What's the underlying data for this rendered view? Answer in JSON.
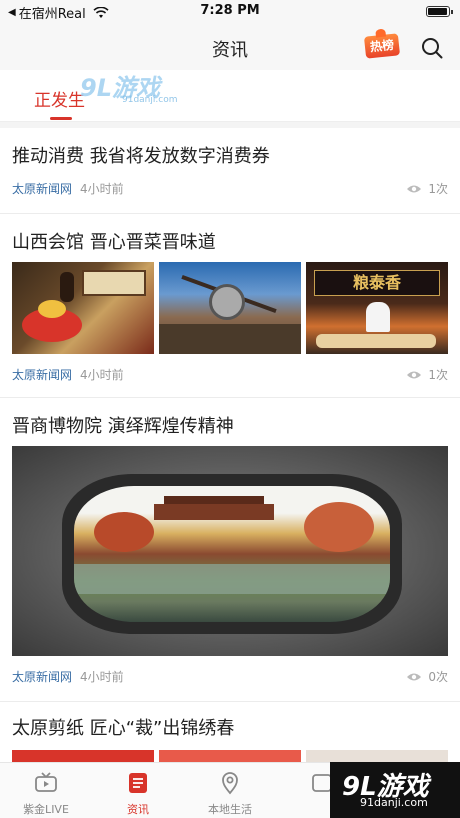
{
  "status_bar": {
    "back_app": "在宿州Real",
    "time": "7:28 PM"
  },
  "nav": {
    "title": "资讯",
    "hot_badge": "热榜"
  },
  "channel": {
    "active_tab": "正发生"
  },
  "articles": [
    {
      "title": "推动消费 我省将发放数字消费券",
      "source": "太原新闻网",
      "time": "4小时前",
      "views": "1次"
    },
    {
      "title": "山西会馆 晋心晋菜晋味道",
      "source": "太原新闻网",
      "time": "4小时前",
      "views": "1次",
      "image_sign_text": "粮泰香"
    },
    {
      "title": "晋商博物院 演绎辉煌传精神",
      "source": "太原新闻网",
      "time": "4小时前",
      "views": "0次"
    },
    {
      "title": "太原剪纸 匠心“裁”出锦绣春"
    }
  ],
  "tab_bar": {
    "tabs": [
      {
        "label": "紫金LIVE"
      },
      {
        "label": "资讯"
      },
      {
        "label": "本地生活"
      }
    ]
  },
  "watermark": {
    "logo": "9L游戏",
    "url": "91danji.com"
  },
  "colors": {
    "accent": "#d8342a",
    "source_link": "#3a6ea5",
    "muted": "#999999"
  }
}
